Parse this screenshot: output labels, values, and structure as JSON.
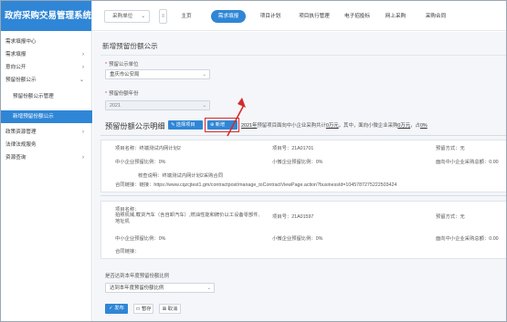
{
  "app": {
    "title": "政府采购交易管理系统"
  },
  "sidebar": {
    "items": [
      {
        "label": "需求填报中心",
        "chevron": false
      },
      {
        "label": "需求填报",
        "chevron": true
      },
      {
        "label": "意向公开",
        "chevron": true
      },
      {
        "label": "预留份额公示",
        "chevron": true
      },
      {
        "label": "预留份额公示管理",
        "chevron": false,
        "sub": true
      },
      {
        "label": "新增预留份额公示",
        "chevron": false,
        "sub": true,
        "active": true
      },
      {
        "label": "政策资源管理",
        "chevron": true
      },
      {
        "label": "法律法规服务",
        "chevron": false
      },
      {
        "label": "资源查询",
        "chevron": true
      }
    ]
  },
  "topbar": {
    "unit_select": "采购单位",
    "nav": [
      "主页",
      "需求填报",
      "项目计划",
      "项目执行管理",
      "电子招投标",
      "网上采购",
      "采购合同"
    ],
    "active_index": 1
  },
  "main": {
    "title": "新增预留份额公示",
    "unit_label": "预留公示单位",
    "unit_value": "重庆市公安局",
    "year_label": "预留份额年份",
    "year_value": "2021",
    "section_title": "预留份额公示明细",
    "btn_select_project": "选择项目",
    "btn_add": "新增",
    "summary": {
      "year": "2021年",
      "text1": "预留项目面向中小企业采购共计",
      "amount1": "0万元",
      "text2": "，其中，面向小微企业采购",
      "amount2": "0万元",
      "text3": "，占",
      "percent": "0%"
    },
    "records": [
      {
        "name_label": "项目名称：",
        "name_value": "终端测试内网计划2",
        "no_label": "项目号：",
        "no_value": "21A01701",
        "method_label": "预留方式：",
        "method_value": "无",
        "sme_label": "中小企业预留比例：",
        "sme_value": "0%",
        "micro_label": "小微企业预留比例：",
        "micro_value": "0%",
        "sme_amount_label": "面向中小企业采购总额：",
        "sme_amount_value": "0.00",
        "note_label": "核查说明：",
        "note_value": "终端测试内网计划2采购合同",
        "contract_label": "合同链接：",
        "contract_value": "链接：https://www.cqzcjtest1.gm/contractpost/manage_toContractViewPage.action?businessId=1045787275222503424"
      },
      {
        "name_label": "项目名称：",
        "name_value": "拍照机械,载货汽车（含自卸汽车）,燃油性能和牌价以工设备零部件,地址机",
        "no_label": "项目号：",
        "no_value": "21A01597",
        "method_label": "预留方式：",
        "method_value": "无",
        "sme_label": "中小企业预留比例：",
        "sme_value": "0%",
        "micro_label": "小微企业预留比例：",
        "micro_value": "0%",
        "sme_amount_label": "面向中小企业采购总额：",
        "sme_amount_value": "0.00",
        "contract_label": "合同链接：",
        "contract_value": ""
      }
    ],
    "question": "是否达到本年度预留份额比例",
    "answer": "达到本年度预留份额比例",
    "btn_publish": "发布",
    "btn_save": "暂存",
    "btn_cancel": "取消"
  },
  "colors": {
    "brand": "#2f86d6",
    "highlight": "#d52b2b"
  }
}
